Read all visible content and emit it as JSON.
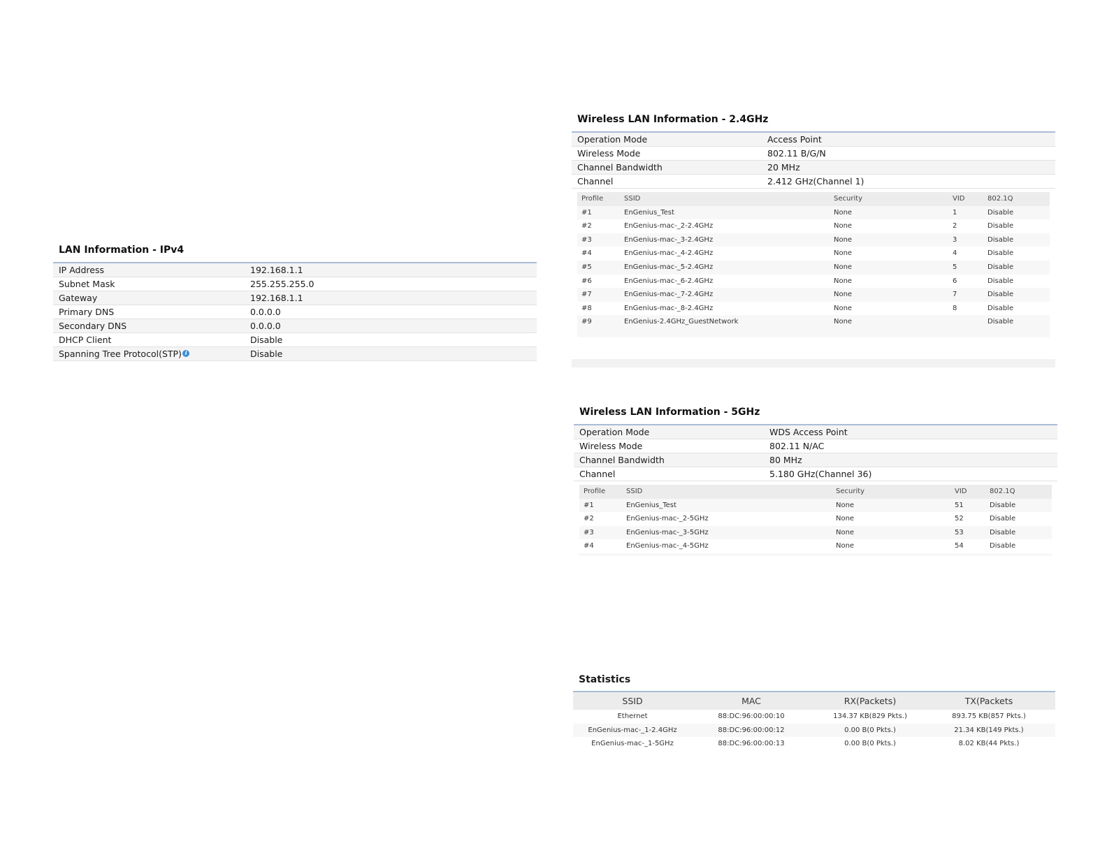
{
  "lan": {
    "title": "LAN Information - IPv4",
    "rows": [
      {
        "label": "IP Address",
        "value": "192.168.1.1"
      },
      {
        "label": "Subnet Mask",
        "value": "255.255.255.0"
      },
      {
        "label": "Gateway",
        "value": "192.168.1.1"
      },
      {
        "label": "Primary DNS",
        "value": "0.0.0.0"
      },
      {
        "label": "Secondary DNS",
        "value": "0.0.0.0"
      },
      {
        "label": "DHCP Client",
        "value": "Disable"
      },
      {
        "label": "Spanning Tree Protocol(STP)",
        "value": "Disable"
      }
    ],
    "info_icon_glyph": "i"
  },
  "wlan24": {
    "title": "Wireless LAN Information - 2.4GHz",
    "rows": [
      {
        "label": "Operation Mode",
        "value": "Access Point"
      },
      {
        "label": "Wireless Mode",
        "value": "802.11 B/G/N"
      },
      {
        "label": "Channel Bandwidth",
        "value": "20 MHz"
      },
      {
        "label": "Channel",
        "value": "2.412 GHz(Channel 1)"
      }
    ],
    "profiles_header": {
      "profile": "Profile",
      "ssid": "SSID",
      "security": "Security",
      "vid": "VID",
      "q": "802.1Q"
    },
    "profiles": [
      {
        "profile": "#1",
        "ssid": "EnGenius_Test",
        "security": "None",
        "vid": "1",
        "q": "Disable"
      },
      {
        "profile": "#2",
        "ssid": "EnGenius-mac-_2-2.4GHz",
        "security": "None",
        "vid": "2",
        "q": "Disable"
      },
      {
        "profile": "#3",
        "ssid": "EnGenius-mac-_3-2.4GHz",
        "security": "None",
        "vid": "3",
        "q": "Disable"
      },
      {
        "profile": "#4",
        "ssid": "EnGenius-mac-_4-2.4GHz",
        "security": "None",
        "vid": "4",
        "q": "Disable"
      },
      {
        "profile": "#5",
        "ssid": "EnGenius-mac-_5-2.4GHz",
        "security": "None",
        "vid": "5",
        "q": "Disable"
      },
      {
        "profile": "#6",
        "ssid": "EnGenius-mac-_6-2.4GHz",
        "security": "None",
        "vid": "6",
        "q": "Disable"
      },
      {
        "profile": "#7",
        "ssid": "EnGenius-mac-_7-2.4GHz",
        "security": "None",
        "vid": "7",
        "q": "Disable"
      },
      {
        "profile": "#8",
        "ssid": "EnGenius-mac-_8-2.4GHz",
        "security": "None",
        "vid": "8",
        "q": "Disable"
      },
      {
        "profile": "#9",
        "ssid": "EnGenius-2.4GHz_GuestNetwork",
        "security": "None",
        "vid": "",
        "q": "Disable"
      }
    ]
  },
  "wlan5": {
    "title": "Wireless LAN Information - 5GHz",
    "rows": [
      {
        "label": "Operation Mode",
        "value": "WDS Access Point"
      },
      {
        "label": "Wireless Mode",
        "value": "802.11 N/AC"
      },
      {
        "label": "Channel Bandwidth",
        "value": "80 MHz"
      },
      {
        "label": "Channel",
        "value": "5.180 GHz(Channel 36)"
      }
    ],
    "profiles_header": {
      "profile": "Profile",
      "ssid": "SSID",
      "security": "Security",
      "vid": "VID",
      "q": "802.1Q"
    },
    "profiles": [
      {
        "profile": "#1",
        "ssid": "EnGenius_Test",
        "security": "None",
        "vid": "51",
        "q": "Disable"
      },
      {
        "profile": "#2",
        "ssid": "EnGenius-mac-_2-5GHz",
        "security": "None",
        "vid": "52",
        "q": "Disable"
      },
      {
        "profile": "#3",
        "ssid": "EnGenius-mac-_3-5GHz",
        "security": "None",
        "vid": "53",
        "q": "Disable"
      },
      {
        "profile": "#4",
        "ssid": "EnGenius-mac-_4-5GHz",
        "security": "None",
        "vid": "54",
        "q": "Disable"
      }
    ]
  },
  "stats": {
    "title": "Statistics",
    "header": {
      "ssid": "SSID",
      "mac": "MAC",
      "rx": "RX(Packets)",
      "tx": "TX(Packets"
    },
    "rows": [
      {
        "ssid": "Ethernet",
        "mac": "88:DC:96:00:00:10",
        "rx": "134.37 KB(829 Pkts.)",
        "tx": "893.75 KB(857 Pkts.)"
      },
      {
        "ssid": "EnGenius-mac-_1-2.4GHz",
        "mac": "88:DC:96:00:00:12",
        "rx": "0.00 B(0 Pkts.)",
        "tx": "21.34 KB(149 Pkts.)"
      },
      {
        "ssid": "EnGenius-mac-_1-5GHz",
        "mac": "88:DC:96:00:00:13",
        "rx": "0.00 B(0 Pkts.)",
        "tx": "8.02 KB(44 Pkts.)"
      }
    ]
  }
}
